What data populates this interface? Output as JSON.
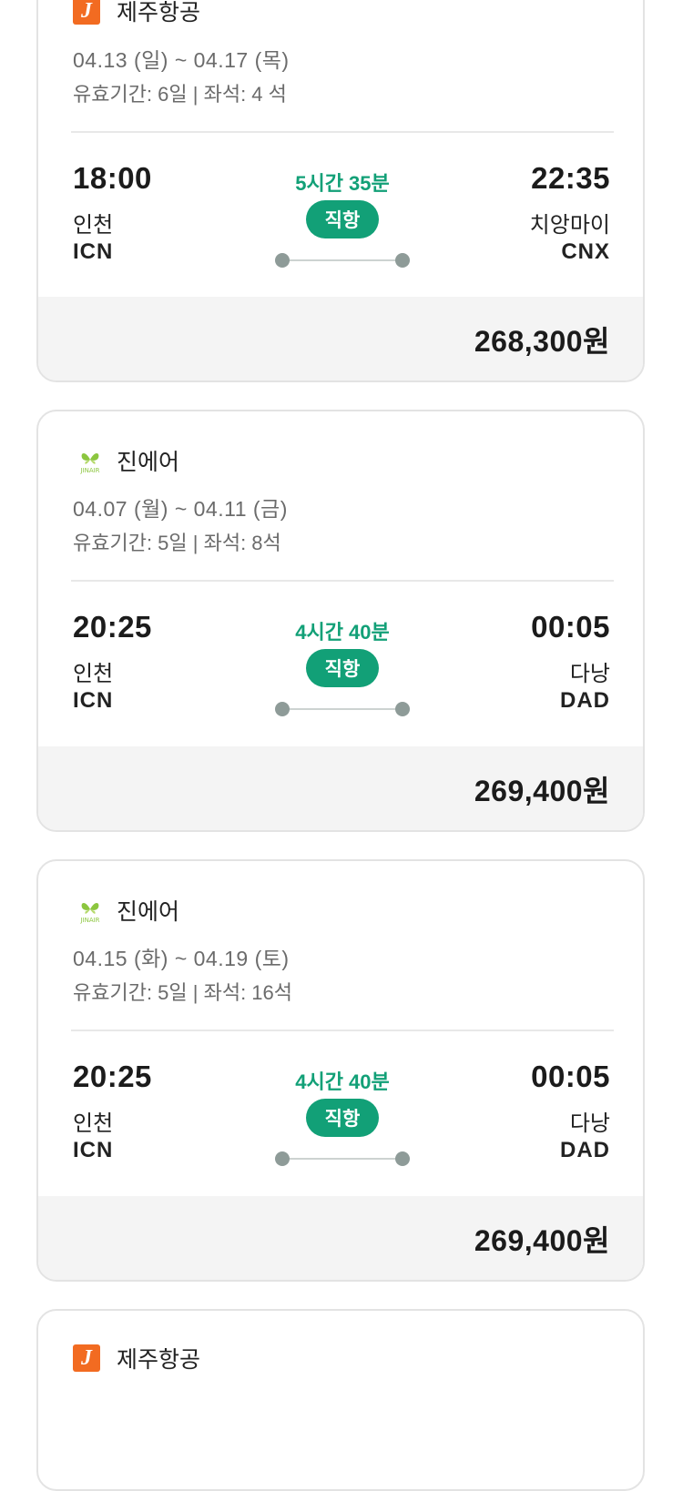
{
  "colors": {
    "accent": "#12a077",
    "jeju": "#f26b21",
    "jinair": "#8cc63f"
  },
  "cards": [
    {
      "airline": "제주항공",
      "logo_icon": "jeju-air-logo",
      "logo_text": "J",
      "dates": "04.13 (일) ~ 04.17 (목)",
      "meta": "유효기간: 6일 | 좌석: 4 석",
      "dep_time": "18:00",
      "dep_city": "인천",
      "dep_code": "ICN",
      "duration": "5시간 35분",
      "direct": "직항",
      "arr_time": "22:35",
      "arr_city": "치앙마이",
      "arr_code": "CNX",
      "price": "268,300원"
    },
    {
      "airline": "진에어",
      "logo_icon": "jin-air-logo",
      "logo_text": "JINAIR",
      "dates": "04.07 (월) ~ 04.11 (금)",
      "meta": "유효기간: 5일 | 좌석: 8석",
      "dep_time": "20:25",
      "dep_city": "인천",
      "dep_code": "ICN",
      "duration": "4시간 40분",
      "direct": "직항",
      "arr_time": "00:05",
      "arr_city": "다낭",
      "arr_code": "DAD",
      "price": "269,400원"
    },
    {
      "airline": "진에어",
      "logo_icon": "jin-air-logo",
      "logo_text": "JINAIR",
      "dates": "04.15 (화) ~ 04.19 (토)",
      "meta": "유효기간: 5일 | 좌석: 16석",
      "dep_time": "20:25",
      "dep_city": "인천",
      "dep_code": "ICN",
      "duration": "4시간 40분",
      "direct": "직항",
      "arr_time": "00:05",
      "arr_city": "다낭",
      "arr_code": "DAD",
      "price": "269,400원"
    },
    {
      "airline": "제주항공",
      "logo_icon": "jeju-air-logo",
      "logo_text": "J"
    }
  ]
}
